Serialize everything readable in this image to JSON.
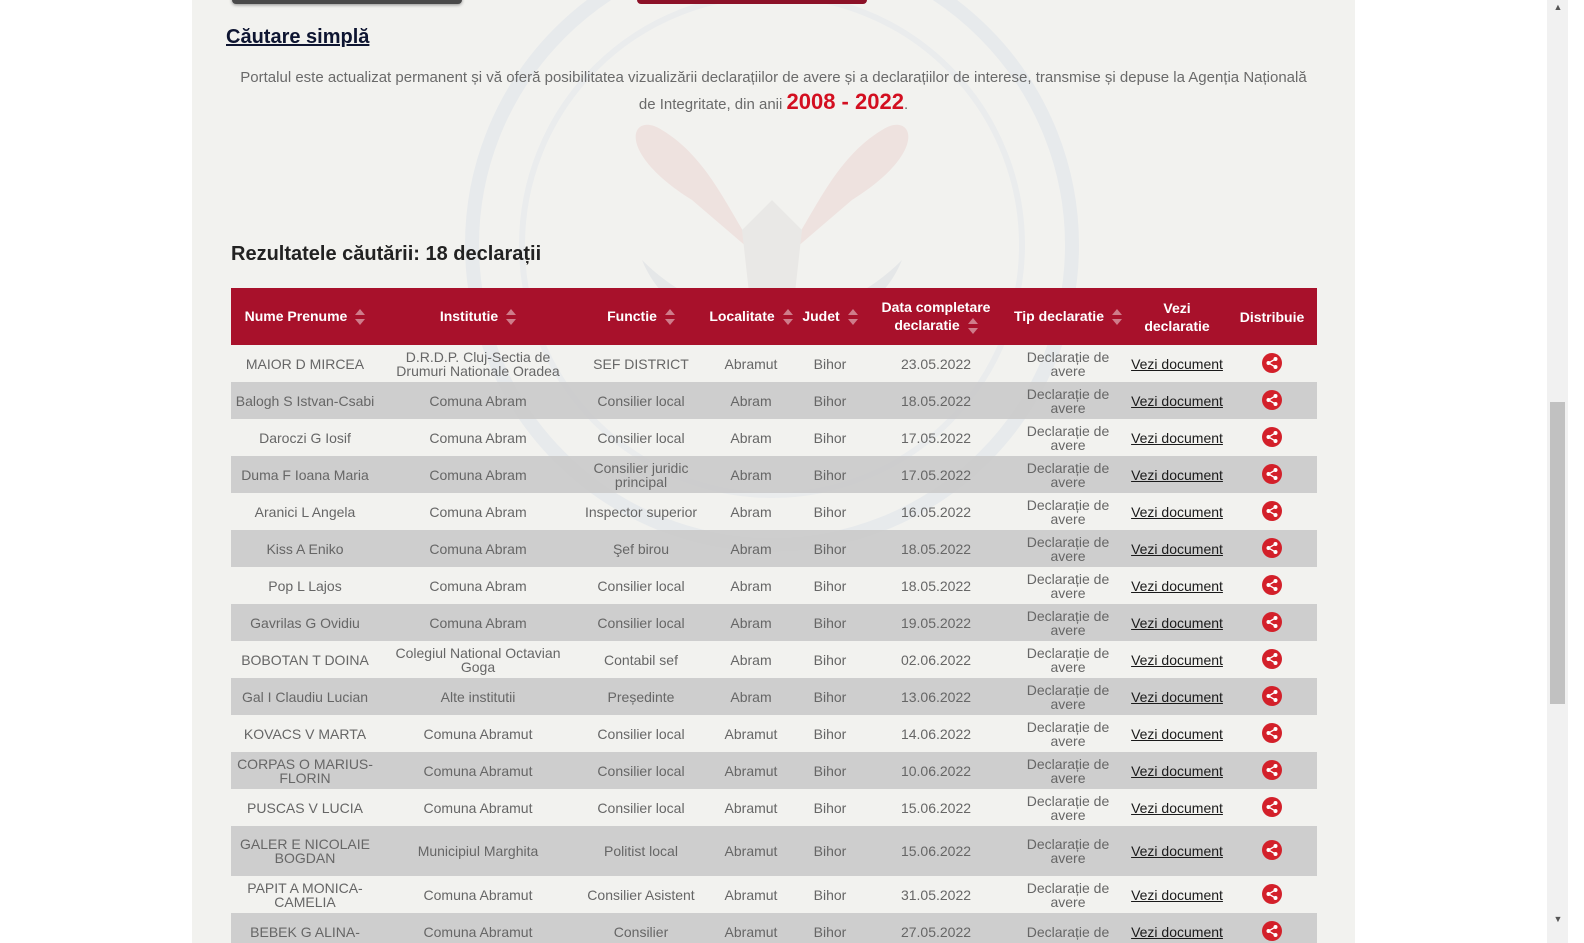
{
  "section": {
    "title": "Căutare simplă",
    "intro": "Portalul este actualizat permanent și vă oferă posibilitatea vizualizării declarațiilor de avere și a declarațiilor de interese, transmise și depuse la Agenția Națională de Integritate, din anii",
    "years": "2008 - 2022",
    "intro_end": "."
  },
  "results": {
    "heading": "Rezultatele căutării: 18 declarații"
  },
  "table": {
    "columns": [
      "Nume Prenume",
      "Institutie",
      "Functie",
      "Localitate",
      "Judet",
      "Data completare declaratie",
      "Tip declaratie",
      "Vezi declaratie",
      "Distribuie"
    ],
    "link_label": "Vezi document",
    "rows": [
      [
        "MAIOR D MIRCEA",
        "D.R.D.P. Cluj-Sectia de Drumuri Nationale Oradea",
        "SEF DISTRICT",
        "Abramut",
        "Bihor",
        "23.05.2022",
        "Declarație de avere"
      ],
      [
        "Balogh S Istvan-Csabi",
        "Comuna Abram",
        "Consilier local",
        "Abram",
        "Bihor",
        "18.05.2022",
        "Declarație de avere"
      ],
      [
        "Daroczi G Iosif",
        "Comuna Abram",
        "Consilier local",
        "Abram",
        "Bihor",
        "17.05.2022",
        "Declarație de avere"
      ],
      [
        "Duma F Ioana Maria",
        "Comuna Abram",
        "Consilier juridic principal",
        "Abram",
        "Bihor",
        "17.05.2022",
        "Declarație de avere"
      ],
      [
        "Aranici L Angela",
        "Comuna Abram",
        "Inspector superior",
        "Abram",
        "Bihor",
        "16.05.2022",
        "Declarație de avere"
      ],
      [
        "Kiss A Eniko",
        "Comuna Abram",
        "Şef birou",
        "Abram",
        "Bihor",
        "18.05.2022",
        "Declarație de avere"
      ],
      [
        "Pop L Lajos",
        "Comuna Abram",
        "Consilier local",
        "Abram",
        "Bihor",
        "18.05.2022",
        "Declarație de avere"
      ],
      [
        "Gavrilas G Ovidiu",
        "Comuna Abram",
        "Consilier local",
        "Abram",
        "Bihor",
        "19.05.2022",
        "Declarație de avere"
      ],
      [
        "BOBOTAN T DOINA",
        "Colegiul National Octavian Goga",
        "Contabil sef",
        "Abram",
        "Bihor",
        "02.06.2022",
        "Declarație de avere"
      ],
      [
        "Gal I Claudiu Lucian",
        "Alte institutii",
        "Președinte",
        "Abram",
        "Bihor",
        "13.06.2022",
        "Declarație de avere"
      ],
      [
        "KOVACS V MARTA",
        "Comuna Abramut",
        "Consilier local",
        "Abramut",
        "Bihor",
        "14.06.2022",
        "Declarație de avere"
      ],
      [
        "CORPAS O MARIUS-FLORIN",
        "Comuna Abramut",
        "Consilier local",
        "Abramut",
        "Bihor",
        "10.06.2022",
        "Declarație de avere"
      ],
      [
        "PUSCAS V LUCIA",
        "Comuna Abramut",
        "Consilier local",
        "Abramut",
        "Bihor",
        "15.06.2022",
        "Declarație de avere"
      ],
      [
        "GALER E NICOLAIE BOGDAN",
        "Municipiul Marghita",
        "Politist local",
        "Abramut",
        "Bihor",
        "15.06.2022",
        "Declarație de avere"
      ],
      [
        "PAPIT A MONICA-CAMELIA",
        "Comuna Abramut",
        "Consilier Asistent",
        "Abramut",
        "Bihor",
        "31.05.2022",
        "Declarație de avere"
      ],
      [
        "BEBEK G ALINA-",
        "Comuna Abramut",
        "Consilier",
        "Abramut",
        "Bihor",
        "27.05.2022",
        "Declarație de"
      ]
    ]
  },
  "colors": {
    "header_red": "#a8112b",
    "accent_red": "#d30f20",
    "share_red": "#d3202a"
  },
  "icons": {
    "sort": "sort-arrows-icon",
    "share": "share-icon"
  }
}
